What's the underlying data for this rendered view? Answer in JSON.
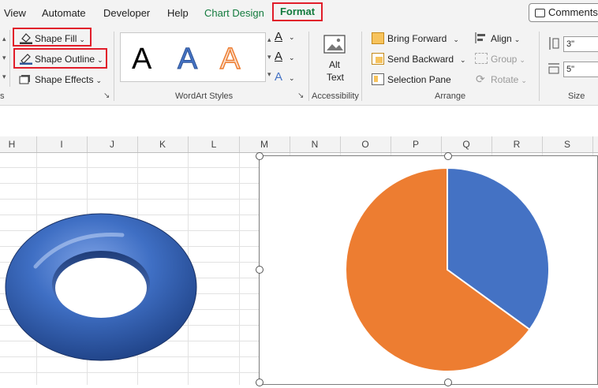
{
  "menu": {
    "tabs": [
      "View",
      "Automate",
      "Developer",
      "Help",
      "Chart Design"
    ],
    "active_tab": "Format",
    "comments": "Comments"
  },
  "shape_styles": {
    "fill": "Shape Fill",
    "outline": "Shape Outline",
    "effects": "Shape Effects",
    "group_label_tail": "s"
  },
  "wordart": {
    "samples": [
      "A",
      "A",
      "A"
    ],
    "label": "WordArt Styles",
    "text_fill_glyph": "A",
    "text_outline_glyph": "A",
    "text_effects_glyph": "A"
  },
  "accessibility": {
    "alt_text_line1": "Alt",
    "alt_text_line2": "Text",
    "label": "Accessibility"
  },
  "arrange": {
    "bring_forward": "Bring Forward",
    "send_backward": "Send Backward",
    "selection_pane": "Selection Pane",
    "align": "Align",
    "group": "Group",
    "rotate": "Rotate",
    "label": "Arrange"
  },
  "size": {
    "height": "3\"",
    "width": "5\"",
    "label": "Size"
  },
  "columns": [
    "H",
    "I",
    "J",
    "K",
    "L",
    "M",
    "N",
    "O",
    "P",
    "Q",
    "R",
    "S"
  ],
  "colors": {
    "accent_green": "#127a3d",
    "highlight_red": "#e11d2a",
    "torus_blue": "#3f6fc4",
    "pie_blue": "#4472c4",
    "pie_orange": "#ed7d31"
  },
  "chart_data": {
    "type": "pie",
    "values": [
      35,
      65
    ],
    "colors": [
      "#4472c4",
      "#ed7d31"
    ],
    "start_angle_deg": 0,
    "direction": "clockwise"
  }
}
